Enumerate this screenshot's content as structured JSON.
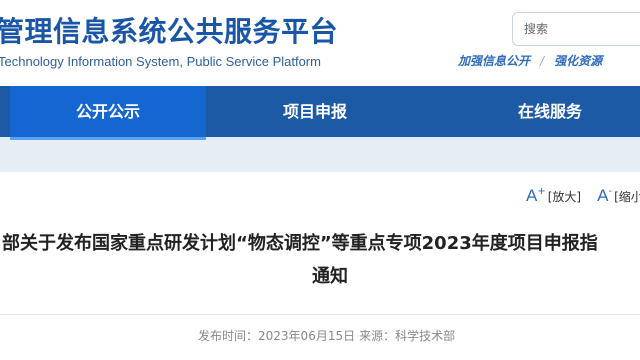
{
  "header": {
    "site_title": "管理信息系统公共服务平台",
    "site_subtitle": "Technology Information System, Public Service Platform",
    "search_placeholder": "搜索",
    "quick_links": [
      "加强信息公开",
      "强化资源"
    ]
  },
  "nav": {
    "items": [
      {
        "label": "公开公示",
        "active": true
      },
      {
        "label": "项目申报",
        "active": false
      },
      {
        "label": "在线服务",
        "active": false
      }
    ]
  },
  "tools": {
    "enlarge_label": "[放大]",
    "shrink_label": "[缩小"
  },
  "article": {
    "title_line1": "部关于发布国家重点研发计划“物态调控”等重点专项2023年度项目申报指",
    "title_line2": "通知",
    "publish_label": "发布时间：",
    "publish_date": "2023年06月15日",
    "source_label": "来源：",
    "source": "科学技术部"
  },
  "colors": {
    "brand_blue": "#1a56a8",
    "nav_bg": "#1d5aa6",
    "nav_active": "#1466d0"
  }
}
